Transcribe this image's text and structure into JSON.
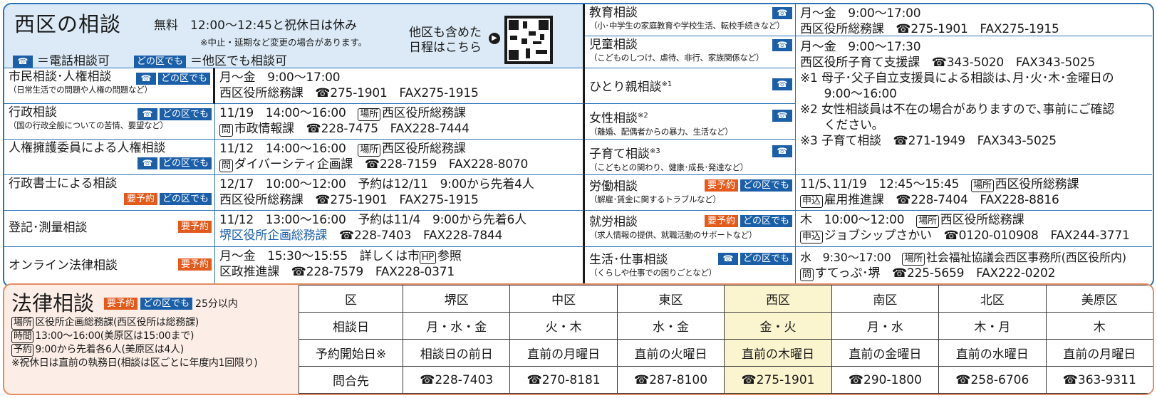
{
  "header": {
    "title": "西区の相談",
    "free_hours": "無料　12:00～12:45と祝休日は休み",
    "note": "※中止・延期など変更の場合があります。",
    "legend_tel": "＝電話相談可",
    "legend_any": "＝他区でも相談可",
    "other_wards": "他区も含めた日程はこちら"
  },
  "tags": {
    "tel": "☎",
    "any": "どの区でも",
    "reserve": "要予約"
  },
  "left_rows": [
    {
      "title": "市民相談･人権相談",
      "sub": "（日常生活での問題や人権の問題など）",
      "line1": "月～金　9:00～17:00",
      "line2": "西区役所総務課　☎275-1901　FAX275-1915"
    },
    {
      "title": "行政相談",
      "sub": "（国の行政全般についての苦情、要望など）",
      "line1_box": "場所",
      "line1": "11/19　14:00～16:00　",
      "line1b": "西区役所総務課",
      "line2_box": "問",
      "line2": "市政情報課　☎228-7475　FAX228-7444"
    },
    {
      "title": "人権擁護委員による人権相談",
      "line1_box": "場所",
      "line1": "11/12　14:00～16:00　",
      "line1b": "西区役所総務課",
      "line2_box": "問",
      "line2": "ダイバーシティ企画課　☎228-7159　FAX228-8070"
    },
    {
      "title": "行政書士による相談",
      "line1": "12/17　10:00～12:00　予約は12/11　9:00から先着4人",
      "line2": "西区役所総務課　☎275-1901　FAX275-1915"
    },
    {
      "title": "登記･測量相談",
      "line1": "11/12　13:00～16:00　予約は11/4　9:00から先着6人",
      "line2a": "堺区役所企画総務課",
      "line2": "　☎228-7403　FAX228-7844"
    },
    {
      "title": "オンライン法律相談",
      "line1_pre": "月～金　15:30～15:55　詳しくは市",
      "line1_box": "HP",
      "line1_post": "参照",
      "line2": "区政推進課　☎228-7579　FAX228-0371"
    }
  ],
  "right_rows": [
    {
      "title": "教育相談",
      "sub": "（小･中学生の家庭教育や学校生活、転校手続きなど）"
    },
    {
      "title": "児童相談",
      "sub": "（こどものしつけ、虐待、非行、家族関係など）"
    },
    {
      "title": "ひとり親相談",
      "mark": "※1"
    },
    {
      "title": "女性相談",
      "mark": "※2",
      "sub": "（離婚、配偶者からの暴力、生活など）"
    },
    {
      "title": "子育て相談",
      "mark": "※3",
      "sub": "（こどもとの関わり、健康･成長･発達など）"
    },
    {
      "title": "労働相談",
      "sub": "（解雇･賃金に関するトラブルなど）"
    },
    {
      "title": "就労相談",
      "sub": "（求人情報の提供、就職活動のサポートなど）"
    },
    {
      "title": "生活･仕事相談",
      "sub": "（くらしや仕事での困りごとなど）"
    }
  ],
  "right_info": {
    "edu_line1": "月～金　9:00～17:00",
    "edu_line2": "西区役所総務課　☎275-1901　FAX275-1915",
    "kid": [
      "月～金　9:00～17:30",
      "西区役所子育て支援課　☎343-5020　FAX343-5025",
      "※1 母子･父子自立支援員による相談は､月･火･木･金曜日の",
      "　　9:00～16:00",
      "※2 女性相談員は不在の場合がありますので､事前にご確認",
      "　　ください｡",
      "※3 子育て相談　☎271-1949　FAX343-5025"
    ],
    "labor_line1": "11/5､11/19　12:45～15:45　",
    "labor_line1b": "西区役所総務課",
    "labor_box1": "場所",
    "labor_box2": "申込",
    "labor_line2": "雇用推進課　☎228-7404　FAX228-8816",
    "job_line1": "木　10:00～12:00　",
    "job_line1b": "西区役所総務課",
    "job_box1": "場所",
    "job_box2": "申込",
    "job_line2": "ジョブシップさかい　☎0120-010908　FAX244-3771",
    "life_line1": "水　9:30～17:00　",
    "life_line1b": "社会福祉協議会西区事務所(西区役所内)",
    "life_box1": "場所",
    "life_box2": "問",
    "life_line2": "すてっぷ･堺　☎225-5659　FAX222-0202"
  },
  "legal": {
    "title": "法律相談",
    "duration": "25分以内",
    "rows": [
      {
        "box": "場所",
        "text": "区役所企画総務課(西区役所は総務課)"
      },
      {
        "box": "時間",
        "text": "13:00～16:00(美原区は15:00まで)"
      },
      {
        "box": "予約",
        "text": "9:00から先着各6人(美原区は4人)"
      },
      {
        "box": "",
        "text": "※祝休日は直前の執務日(相談は区ごとに年度内1回限り)"
      }
    ],
    "table": {
      "header": [
        "区",
        "堺区",
        "中区",
        "東区",
        "西区",
        "南区",
        "北区",
        "美原区"
      ],
      "days": [
        "相談日",
        "月・水・金",
        "火・木",
        "水・金",
        "金・火",
        "月・水",
        "木・月",
        "木"
      ],
      "start": [
        "予約開始日※",
        "相談日の前日",
        "直前の月曜日",
        "直前の火曜日",
        "直前の木曜日",
        "直前の金曜日",
        "直前の水曜日",
        "直前の月曜日"
      ],
      "contact": [
        "問合先",
        "☎228-7403",
        "☎270-8181",
        "☎287-8100",
        "☎275-1901",
        "☎290-1800",
        "☎258-6706",
        "☎363-9311"
      ]
    },
    "highlight_col": 4
  },
  "colors": {
    "blue": "#1b5fa8",
    "orange": "#e35a1b",
    "header_bg": "#dbeaf6",
    "legal_bg": "#fceee6",
    "highlight": "#fbf5cf"
  }
}
